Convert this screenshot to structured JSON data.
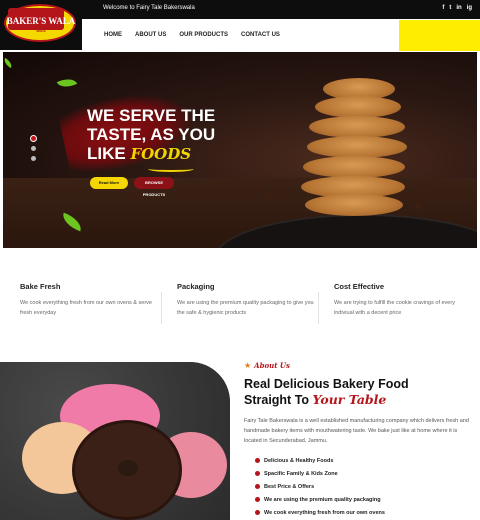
{
  "topbar": {
    "welcome": "Welcome to Fairy Tale Bakerswala",
    "socials": [
      "f",
      "t",
      "in",
      "ig"
    ]
  },
  "logo": {
    "line1": "FAIRY TALE",
    "name": "BAKER'S WALA",
    "line3": "SINCE"
  },
  "nav": {
    "items": [
      "HOME",
      "ABOUT US",
      "OUR PRODUCTS",
      "CONTACT US"
    ]
  },
  "hero": {
    "line1": "WE SERVE THE",
    "line2": "TASTE, AS YOU",
    "line3_prefix": "LIKE",
    "line3_highlight": "FOODS",
    "read_more": "Read More",
    "browse": "BROWSE PRODUCTS"
  },
  "features": [
    {
      "title": "Bake Fresh",
      "text": "We cook everything fresh from our own ovens & serve fresh everyday"
    },
    {
      "title": "Packaging",
      "text": "We are using the premium quality packaging to give you the safe & hygienic products"
    },
    {
      "title": "Cost Effective",
      "text": "We are trying to fulfill the cookie cravings of every indiviual with a decent price"
    }
  ],
  "about": {
    "tag": "About Us",
    "title_line1": "Real Delicious Bakery Food",
    "title_line2_prefix": "Straight To",
    "title_line2_highlight": "Your Table",
    "description": "Fairy Tale Bakerswala is a well established manufacturing company which delivers fresh and handmade bakery items with mouthwatering taste. We bake just like at home where it is located in Secunderabad, Jammu.",
    "list": [
      "Delicious & Healthy Foods",
      "Spacific Family & Kids Zone",
      "Best Price & Offers",
      "We are using the premium quality packaging",
      "We cook everything fresh from our own ovens"
    ]
  },
  "colors": {
    "accent_red": "#b3151b",
    "accent_yellow": "#f6d704",
    "dark": "#0d0d0d"
  }
}
